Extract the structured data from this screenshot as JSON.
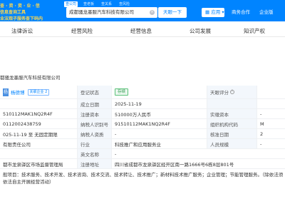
{
  "header": {
    "promo_lines": [
      "查 · 资 · 资 · 业 · 信",
      "信息查询工具",
      "业法观子服务查下码内"
    ],
    "search_tabs": [
      {
        "label": "查公司",
        "active": true
      },
      {
        "label": "查老板",
        "active": false
      },
      {
        "label": "查关系",
        "active": false
      },
      {
        "label": "查风险",
        "active": false
      }
    ],
    "search_value": "成都骚龙墨服汽车科技有限公司",
    "search_button": "天眼一下",
    "app_menu": "应用",
    "links": [
      "商务合作",
      "企业版"
    ]
  },
  "module_tabs": [
    "法律诉讼",
    "经营风险",
    "经营信息",
    "公司发展",
    "知识产权"
  ],
  "company": {
    "name": "都骚龙墨服汽车科技有限公司"
  },
  "info": {
    "avatar_char": "杨",
    "legal_rep": "杨德博",
    "legal_badge": "关联企业 2",
    "rows": [
      {
        "c1": "",
        "l2": "登记状态",
        "v2": "存续",
        "l3": "天眼评分",
        "v3": ""
      },
      {
        "c1": "",
        "l2": "成立日期",
        "v2": "2025-11-19",
        "l3": "",
        "v3": ""
      },
      {
        "c1": "510112MAK1NQ2R4F",
        "l2": "注册资本",
        "v2": "510000万人民币",
        "l3": "实缴资本",
        "v3": "-"
      },
      {
        "c1": "0112002438759",
        "l2": "纳税人识别号",
        "v2": "91510112MAK1NQ2R4F",
        "l3": "组织机构代码",
        "v3": "M"
      },
      {
        "c1": "025-11-19 至 无固定期限",
        "l2": "纳税人资质",
        "v2": "-",
        "l3": "核准日期",
        "v3": "2"
      },
      {
        "c1": "有限责任公司",
        "l2": "行业",
        "v2": "科技推广和应用服务业",
        "l3": "人员规模",
        "v3": "-"
      },
      {
        "c1": "",
        "l2": "英文名称",
        "v2": "-",
        "l3": "",
        "v3": ""
      },
      {
        "c1": "都市龙泉驿区市场监督管理局",
        "l2": "注册地址",
        "v2": "四川省成都市龙泉驿区经开区南一路1666号6栋8层801号",
        "l3": "",
        "v3": ""
      }
    ],
    "business_scope_lines": [
      "般项目：技术服务、技术开发、技术咨询、技术交流、技术转让、技术推广；新材料技术推广服务；企业管理；节能管理服务。（除依法须",
      "依法自主开展经营活动）"
    ]
  }
}
